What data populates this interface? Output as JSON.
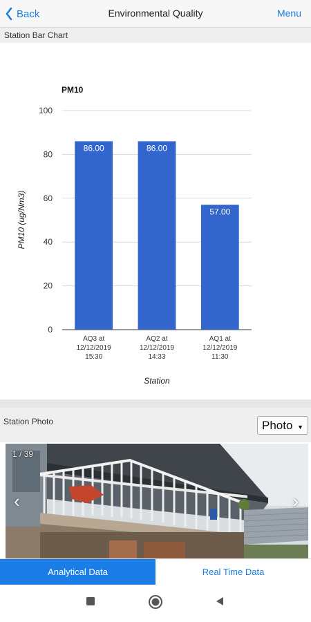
{
  "header": {
    "back_label": "Back",
    "title": "Environmental Quality",
    "menu_label": "Menu"
  },
  "chart_section": {
    "title": "Station Bar Chart"
  },
  "chart_data": {
    "type": "bar",
    "title": "PM10",
    "xlabel": "Station",
    "ylabel": "PM10 (ug/Nm3)",
    "ylim": [
      0,
      100
    ],
    "yticks": [
      0,
      20,
      40,
      60,
      80,
      100
    ],
    "categories": [
      [
        "AQ3 at",
        "12/12/2019",
        "15:30"
      ],
      [
        "AQ2 at",
        "12/12/2019",
        "14:33"
      ],
      [
        "AQ1 at",
        "12/12/2019",
        "11:30"
      ]
    ],
    "values": [
      86,
      86,
      57
    ],
    "data_labels": [
      "86.00",
      "86.00",
      "57.00"
    ],
    "bar_color": "#3366cc",
    "grid": true
  },
  "photo_section": {
    "title": "Station Photo",
    "select_value": "Photo",
    "counter": "1 / 39",
    "prev_arrow": "‹",
    "next_arrow": "›"
  },
  "tabs": [
    {
      "label": "Analytical Data",
      "active": true
    },
    {
      "label": "Real Time Data",
      "active": false
    }
  ],
  "colors": {
    "accent": "#1a7ee6",
    "bar": "#3366cc"
  }
}
